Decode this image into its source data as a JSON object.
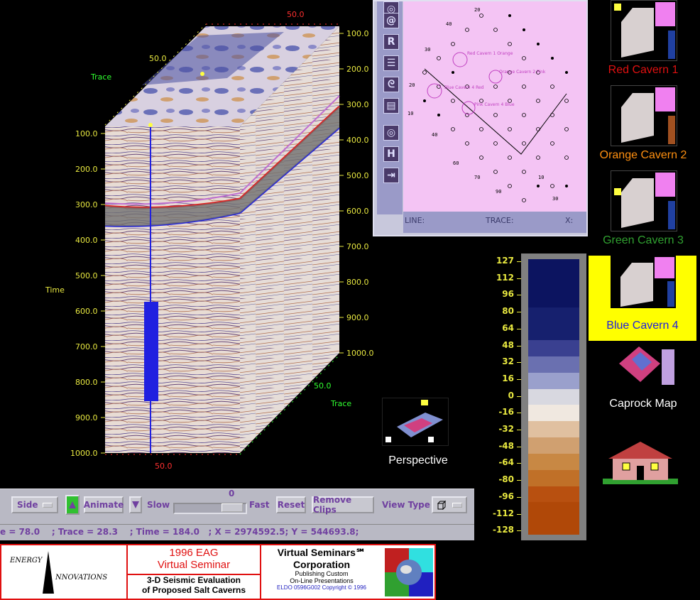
{
  "viewer": {
    "trace_label_top": "Trace",
    "trace_label_bottom": "Trace",
    "time_label": "Time",
    "top_axis_value_red": "50.0",
    "top_axis_value_yellow": "50.0",
    "bottom_axis_value_red": "50.0",
    "bottom_axis_value_green": "50.0",
    "left_axis_ticks": [
      "100.0",
      "200.0",
      "300.0",
      "400.0",
      "500.0",
      "600.0",
      "700.0",
      "800.0",
      "900.0",
      "1000.0"
    ],
    "right_axis_ticks": [
      "100.0",
      "200.0",
      "300.0",
      "400.0",
      "500.0",
      "600.0",
      "700.0",
      "800.0",
      "900.0",
      "1000.0"
    ]
  },
  "toolbar": {
    "side_label": "Side",
    "animate_label": "Animate",
    "slow_label": "Slow",
    "slider_value": "0",
    "fast_label": "Fast",
    "reset_label": "Reset",
    "remove_clips_label": "Remove Clips",
    "view_type_label": "View Type",
    "side_arrow_icon": "up-triangle-icon",
    "speed_arrow_icon": "down-triangle-icon"
  },
  "status_bar": {
    "text": "e = 78.0    ; Trace = 28.3    ; Time = 184.0   ; X = 2974592.5; Y = 544693.8;"
  },
  "map_window": {
    "line_label": "LINE:",
    "trace_label": "TRACE:",
    "x_label": "X:",
    "tools": [
      "R",
      "H"
    ],
    "cavern_labels": [
      "Red Cavern 1 Orange",
      "Orange Cavern 2 Pink",
      "Blue Cavern 4 Red",
      "Pink Cavern 4 Blue"
    ]
  },
  "color_bar": {
    "labels": [
      "127",
      "112",
      "96",
      "80",
      "64",
      "48",
      "32",
      "16",
      "0",
      "-16",
      "-32",
      "-48",
      "-64",
      "-80",
      "-96",
      "-112",
      "-128"
    ],
    "colors": [
      "#0c1460",
      "#0c1460",
      "#0c1460",
      "#16206e",
      "#16206e",
      "#3a4090",
      "#6a70b0",
      "#9aa0cc",
      "#d8d8e0",
      "#f0e8e0",
      "#e0c0a0",
      "#d0a070",
      "#c88844",
      "#c07028",
      "#b85010",
      "#b04808",
      "#b04808"
    ]
  },
  "thumbnails": [
    {
      "label": "Red Cavern 1",
      "color": "#e01010"
    },
    {
      "label": "Orange Cavern 2",
      "color": "#ff9010"
    },
    {
      "label": "Green Cavern 3",
      "color": "#30a030"
    },
    {
      "label": "Blue Cavern 4",
      "color": "#2020e0"
    },
    {
      "label": "Caprock Map",
      "color": "#ffffff"
    },
    {
      "label": "Perspective",
      "color": "#ffffff"
    }
  ],
  "banner": {
    "logo_line1": "ENERGY",
    "logo_line2": "NNOVATIONS",
    "seminar_title": "1996 EAG",
    "seminar_subtitle": "Virtual Seminar",
    "topic_line1": "3-D Seismic Evaluation",
    "topic_line2": "of Proposed Salt Caverns",
    "vs_title": "Virtual Seminars℠",
    "vs_corp": "Corporation",
    "vs_line1": "Publishing Custom",
    "vs_line2": "On-Line Presentations",
    "copyright": "ELDO 0596G002 Copyright © 1996"
  }
}
